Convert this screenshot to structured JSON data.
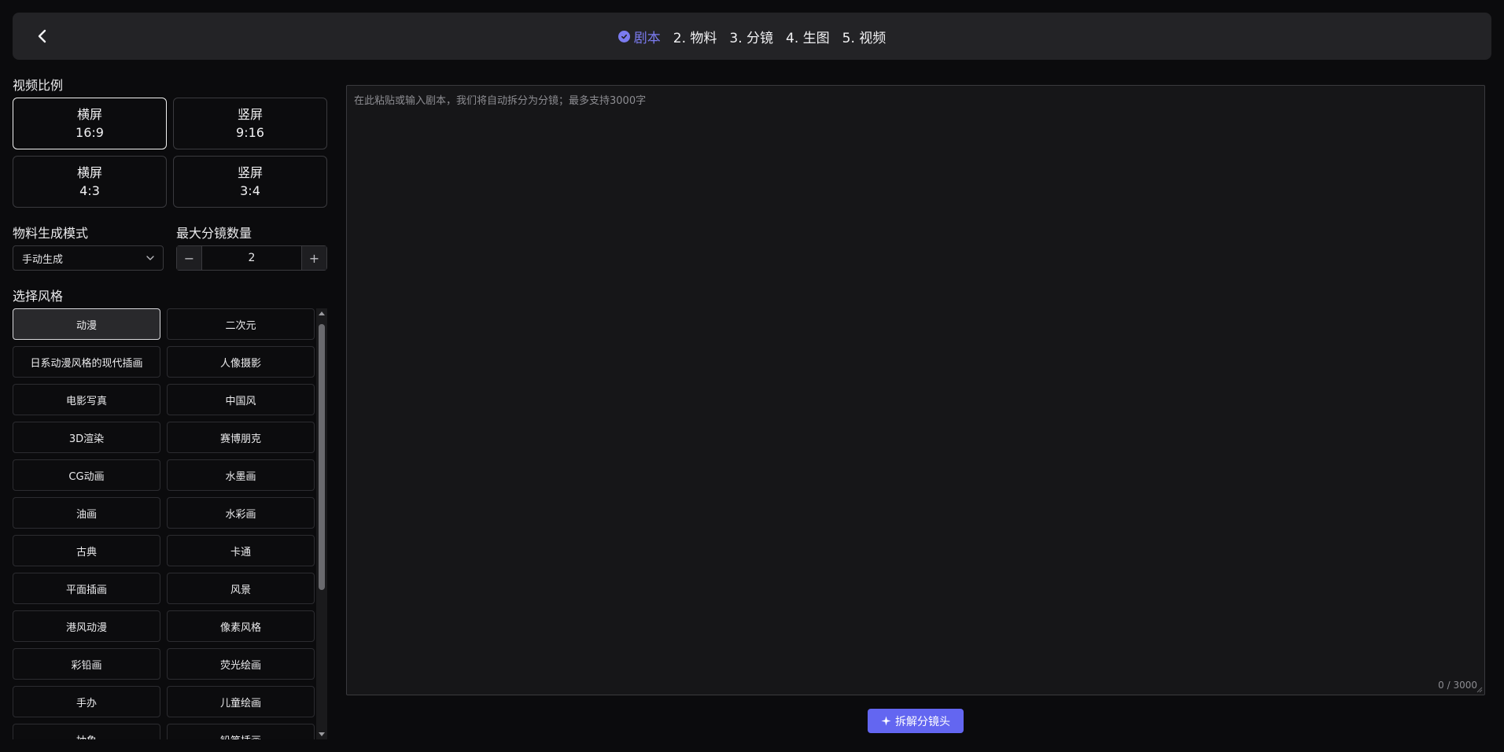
{
  "header": {
    "steps": [
      {
        "label": "剧本"
      },
      {
        "label": "2. 物料"
      },
      {
        "label": "3. 分镜"
      },
      {
        "label": "4. 生图"
      },
      {
        "label": "5. 视频"
      }
    ]
  },
  "ratio": {
    "title": "视频比例",
    "options": [
      {
        "orientation": "横屏",
        "value": "16:9"
      },
      {
        "orientation": "竖屏",
        "value": "9:16"
      },
      {
        "orientation": "横屏",
        "value": "4:3"
      },
      {
        "orientation": "竖屏",
        "value": "3:4"
      }
    ]
  },
  "material_mode": {
    "title": "物料生成模式",
    "selected": "手动生成"
  },
  "max_shots": {
    "title": "最大分镜数量",
    "value": "2",
    "minus": "−",
    "plus": "+"
  },
  "style": {
    "title": "选择风格",
    "items": [
      "动漫",
      "二次元",
      "日系动漫风格的现代插画",
      "人像摄影",
      "电影写真",
      "中国风",
      "3D渲染",
      "赛博朋克",
      "CG动画",
      "水墨画",
      "油画",
      "水彩画",
      "古典",
      "卡通",
      "平面插画",
      "风景",
      "港风动漫",
      "像素风格",
      "彩铅画",
      "荧光绘画",
      "手办",
      "儿童绘画",
      "抽象",
      "铅笔插画"
    ]
  },
  "script": {
    "placeholder": "在此粘贴或输入剧本，我们将自动拆分为分镜；最多支持3000字",
    "value": "",
    "counter": "0 / 3000"
  },
  "actions": {
    "split_label": "拆解分镜头"
  },
  "colors": {
    "accent": "#6366f1",
    "active_step": "#7b7bf0"
  }
}
